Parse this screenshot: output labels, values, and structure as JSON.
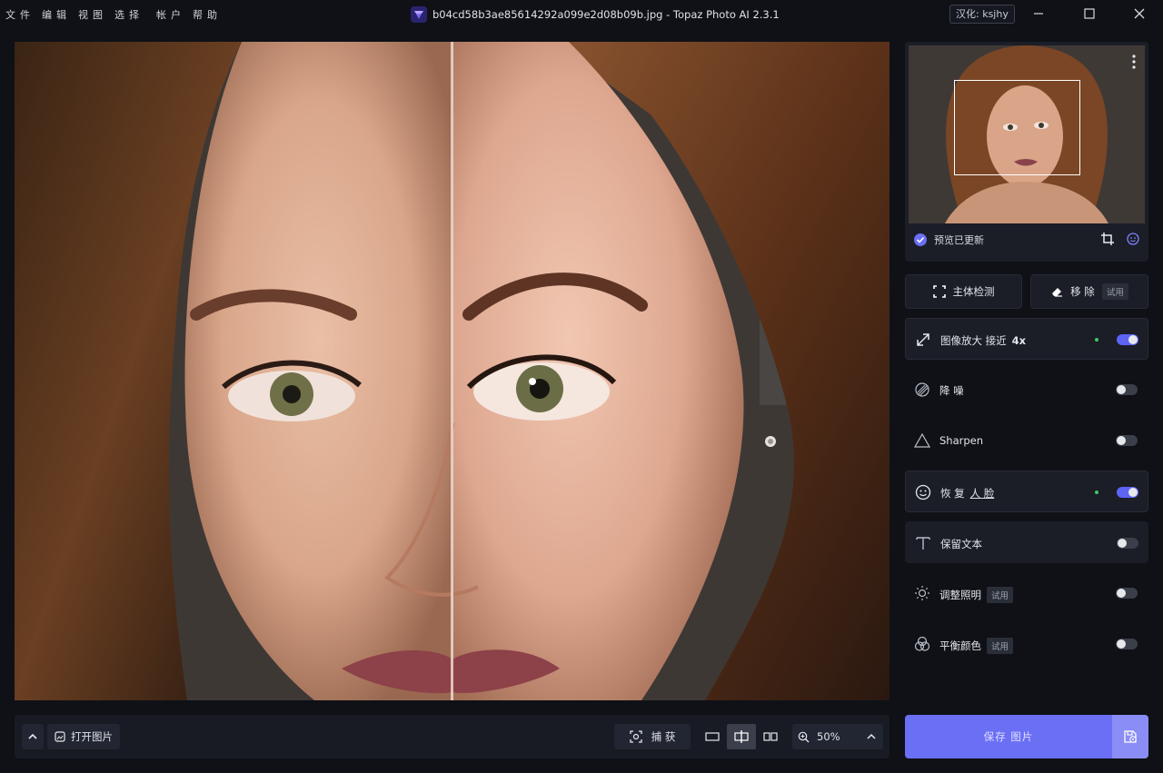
{
  "menu": [
    "文件",
    "编辑",
    "视图",
    "选择",
    "帐户",
    "帮助"
  ],
  "window": {
    "title": "b04cd58b3ae85614292a099e2d08b09b.jpg - Topaz Photo AI 2.3.1",
    "badge": "汉化: ksjhy"
  },
  "preview": {
    "status": "预览已更新"
  },
  "tools": {
    "detect": "主体检测",
    "remove": "移 除",
    "remove_trial": "试用"
  },
  "features": [
    {
      "id": "upscale",
      "label": "图像放大 接近",
      "emph": "4x",
      "on": true,
      "dot": true,
      "icon": "expand-icon"
    },
    {
      "id": "denoise",
      "label": "降 噪",
      "on": false,
      "icon": "noise-icon"
    },
    {
      "id": "sharpen",
      "label": "Sharpen",
      "on": false,
      "icon": "triangle-icon"
    },
    {
      "id": "face",
      "label_a": "恢 复",
      "label_b": "人 脸",
      "on": true,
      "dot": true,
      "icon": "face-icon"
    },
    {
      "id": "text",
      "label": "保留文本",
      "on": false,
      "icon": "text-icon"
    },
    {
      "id": "lighting",
      "label": "调整照明",
      "trial": "试用",
      "on": false,
      "icon": "sun-icon"
    },
    {
      "id": "color",
      "label": "平衡颜色",
      "trial": "试用",
      "on": false,
      "icon": "color-balance-icon"
    }
  ],
  "bottom": {
    "open": "打开图片",
    "capture": "捕 获",
    "zoom": "50%"
  },
  "save": {
    "label": "保存 图片"
  },
  "colors": {
    "accent": "#6b6ff4",
    "active_dot": "#3ec86a"
  }
}
